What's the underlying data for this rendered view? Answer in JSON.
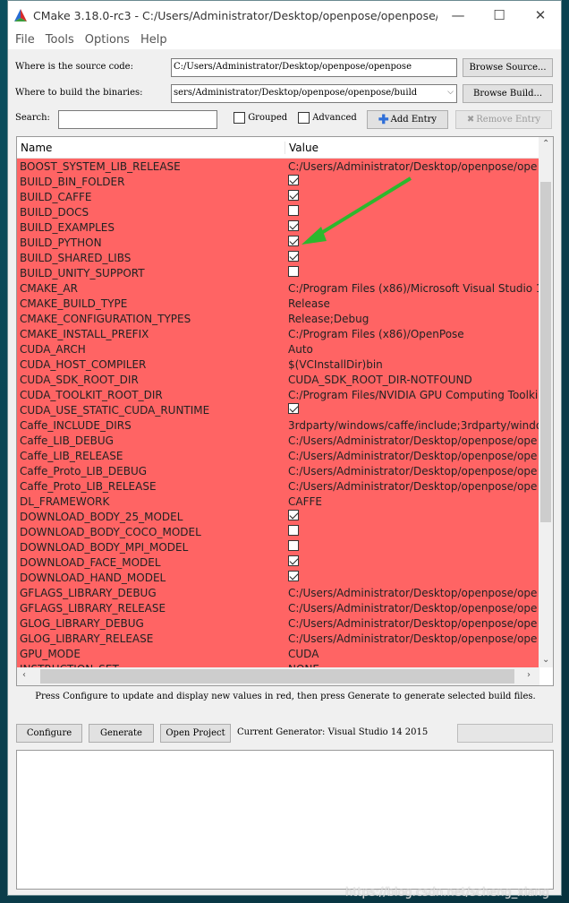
{
  "window": {
    "title": "CMake 3.18.0-rc3 - C:/Users/Administrator/Desktop/openpose/openpose/b...",
    "minimize": "—",
    "maximize": "☐",
    "close": "✕"
  },
  "menu": [
    "File",
    "Tools",
    "Options",
    "Help"
  ],
  "source": {
    "label": "Where is the source code:",
    "value": "C:/Users/Administrator/Desktop/openpose/openpose",
    "browse": "Browse Source..."
  },
  "build": {
    "label": "Where to build the binaries:",
    "value": "sers/Administrator/Desktop/openpose/openpose/build",
    "browse": "Browse Build..."
  },
  "search": {
    "label": "Search:",
    "value": ""
  },
  "options": {
    "grouped": "Grouped",
    "advanced": "Advanced",
    "add_entry": "Add Entry",
    "remove_entry": "Remove Entry"
  },
  "table": {
    "headers": [
      "Name",
      "Value"
    ],
    "rows": [
      {
        "name": "BOOST_SYSTEM_LIB_RELEASE",
        "value": "C:/Users/Administrator/Desktop/openpose/ope"
      },
      {
        "name": "BUILD_BIN_FOLDER",
        "check": true
      },
      {
        "name": "BUILD_CAFFE",
        "check": true
      },
      {
        "name": "BUILD_DOCS",
        "check": false
      },
      {
        "name": "BUILD_EXAMPLES",
        "check": true
      },
      {
        "name": "BUILD_PYTHON",
        "check": true
      },
      {
        "name": "BUILD_SHARED_LIBS",
        "check": true
      },
      {
        "name": "BUILD_UNITY_SUPPORT",
        "check": false
      },
      {
        "name": "CMAKE_AR",
        "value": "C:/Program Files (x86)/Microsoft Visual Studio 1"
      },
      {
        "name": "CMAKE_BUILD_TYPE",
        "value": "Release"
      },
      {
        "name": "CMAKE_CONFIGURATION_TYPES",
        "value": "Release;Debug"
      },
      {
        "name": "CMAKE_INSTALL_PREFIX",
        "value": "C:/Program Files (x86)/OpenPose"
      },
      {
        "name": "CUDA_ARCH",
        "value": "Auto"
      },
      {
        "name": "CUDA_HOST_COMPILER",
        "value": "$(VCInstallDir)bin"
      },
      {
        "name": "CUDA_SDK_ROOT_DIR",
        "value": "CUDA_SDK_ROOT_DIR-NOTFOUND"
      },
      {
        "name": "CUDA_TOOLKIT_ROOT_DIR",
        "value": "C:/Program Files/NVIDIA GPU Computing Toolki"
      },
      {
        "name": "CUDA_USE_STATIC_CUDA_RUNTIME",
        "check": true
      },
      {
        "name": "Caffe_INCLUDE_DIRS",
        "value": "3rdparty/windows/caffe/include;3rdparty/windo"
      },
      {
        "name": "Caffe_LIB_DEBUG",
        "value": "C:/Users/Administrator/Desktop/openpose/ope"
      },
      {
        "name": "Caffe_LIB_RELEASE",
        "value": "C:/Users/Administrator/Desktop/openpose/ope"
      },
      {
        "name": "Caffe_Proto_LIB_DEBUG",
        "value": "C:/Users/Administrator/Desktop/openpose/ope"
      },
      {
        "name": "Caffe_Proto_LIB_RELEASE",
        "value": "C:/Users/Administrator/Desktop/openpose/ope"
      },
      {
        "name": "DL_FRAMEWORK",
        "value": "CAFFE"
      },
      {
        "name": "DOWNLOAD_BODY_25_MODEL",
        "check": true
      },
      {
        "name": "DOWNLOAD_BODY_COCO_MODEL",
        "check": false
      },
      {
        "name": "DOWNLOAD_BODY_MPI_MODEL",
        "check": false
      },
      {
        "name": "DOWNLOAD_FACE_MODEL",
        "check": true
      },
      {
        "name": "DOWNLOAD_HAND_MODEL",
        "check": true
      },
      {
        "name": "GFLAGS_LIBRARY_DEBUG",
        "value": "C:/Users/Administrator/Desktop/openpose/ope"
      },
      {
        "name": "GFLAGS_LIBRARY_RELEASE",
        "value": "C:/Users/Administrator/Desktop/openpose/ope"
      },
      {
        "name": "GLOG_LIBRARY_DEBUG",
        "value": "C:/Users/Administrator/Desktop/openpose/ope"
      },
      {
        "name": "GLOG_LIBRARY_RELEASE",
        "value": "C:/Users/Administrator/Desktop/openpose/ope"
      },
      {
        "name": "GPU_MODE",
        "value": "CUDA"
      },
      {
        "name": "INSTRUCTION_SET",
        "value": "NONE"
      }
    ]
  },
  "message": "Press Configure to update and display new values in red, then press Generate to generate selected build files.",
  "buttons": {
    "configure": "Configure",
    "generate": "Generate",
    "open_project": "Open Project"
  },
  "generator": "Current Generator: Visual Studio 14 2015",
  "watermark": "https://blog.csdn.net/scheng_xiang",
  "colors": {
    "new_value_row": "#ff6464",
    "arrow": "#2db82d"
  }
}
